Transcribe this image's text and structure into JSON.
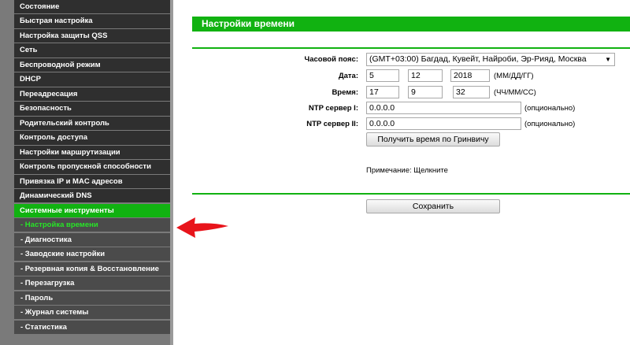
{
  "sidebar": {
    "main_items": [
      "Состояние",
      "Быстрая настройка",
      "Настройка защиты QSS",
      "Сеть",
      "Беспроводной режим",
      "DHCP",
      "Переадресация",
      "Безопасность",
      "Родительский контроль",
      "Контроль доступа",
      "Настройки маршрутизации",
      "Контроль пропускной способности",
      "Привязка IP и MAC адресов",
      "Динамический DNS",
      "Системные инструменты"
    ],
    "sub_items": [
      "- Настройка времени",
      "- Диагностика",
      "- Заводские настройки",
      "- Резервная копия & Восстановление",
      "- Перезагрузка",
      "- Пароль",
      "- Журнал системы",
      "- Статистика"
    ]
  },
  "page": {
    "title": "Настройки времени",
    "timezone_label": "Часовой пояс:",
    "timezone_value": "(GMT+03:00) Багдад, Кувейт, Найроби, Эр-Рияд, Москва",
    "date_label": "Дата:",
    "date_day": "5",
    "date_month": "12",
    "date_year": "2018",
    "date_hint": "(ММ/ДД/ГГ)",
    "time_label": "Время:",
    "time_hour": "17",
    "time_minute": "9",
    "time_second": "32",
    "time_hint": "(ЧЧ/ММ/СС)",
    "ntp1_label": "NTP сервер I:",
    "ntp1_value": "0.0.0.0",
    "ntp1_hint": "(опционально)",
    "ntp2_label": "NTP сервер II:",
    "ntp2_value": "0.0.0.0",
    "ntp2_hint": "(опционально)",
    "gmt_button": "Получить время по Гринвичу",
    "note": "Примечание: Щелкните",
    "save_button": "Сохранить"
  },
  "colors": {
    "accent_green": "#11b211",
    "active_sub_text": "#27e527",
    "menu_dark": "#2f2f2f",
    "menu_sub": "#4b4b4b",
    "arrow_red": "#e8141b"
  },
  "icons": {
    "arrow": "red-arrow-left-icon",
    "select_caret": "triangle-down-icon"
  }
}
